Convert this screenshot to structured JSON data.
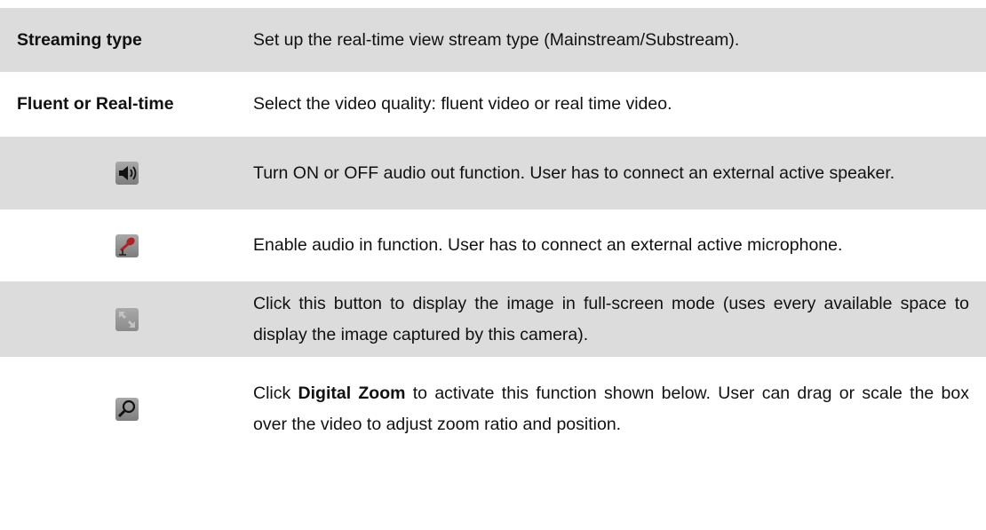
{
  "rows": [
    {
      "label": "Streaming type",
      "description": "Set up the real-time view stream type (Mainstream/Substream)."
    },
    {
      "label": "Fluent or Real-time",
      "description": "Select the video quality: fluent video or real time video."
    },
    {
      "icon": "speaker-icon",
      "description": "Turn ON or OFF audio out function. User has to connect an external active speaker."
    },
    {
      "icon": "microphone-icon",
      "description": "Enable audio in function. User has to connect an external active microphone."
    },
    {
      "icon": "fullscreen-icon",
      "description": "Click this button to display the image in full-screen mode (uses every available space to display the image captured by this camera)."
    },
    {
      "icon": "magnifier-icon",
      "description_prefix": "Click ",
      "description_bold": "Digital Zoom",
      "description_suffix": " to activate this function shown below. User can drag or scale the box over the video to adjust zoom ratio and position."
    }
  ],
  "colors": {
    "row_shade": "#dcdcdc",
    "text": "#111111"
  }
}
